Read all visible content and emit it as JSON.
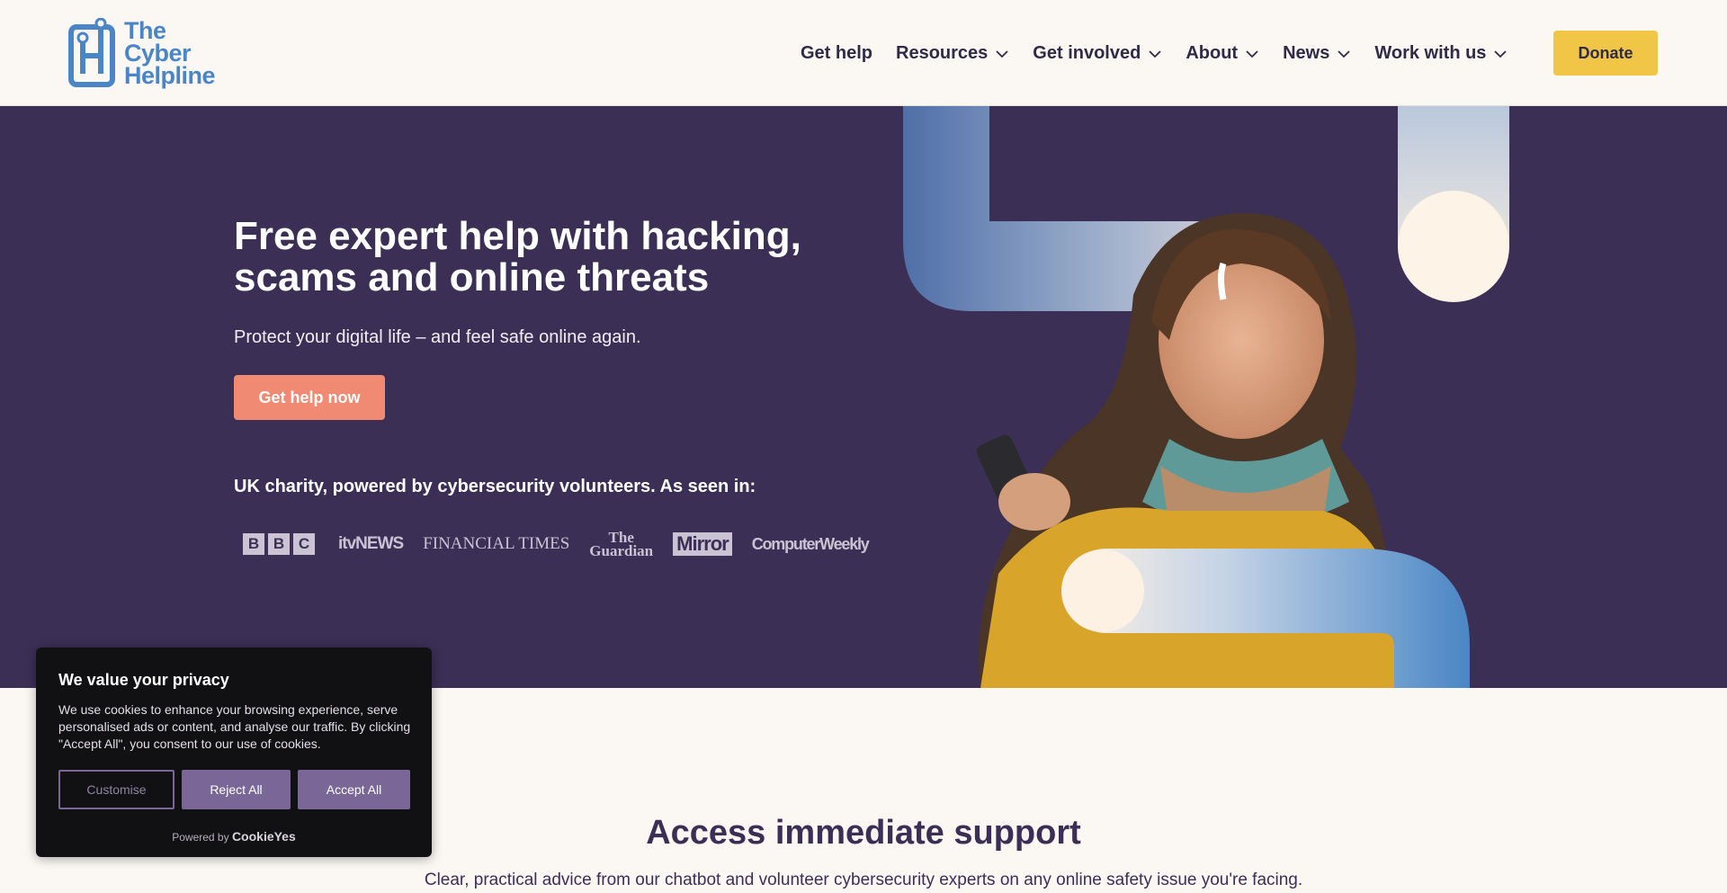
{
  "header": {
    "logo_lines": [
      "The",
      "Cyber",
      "Helpline"
    ],
    "nav": [
      {
        "label": "Get help",
        "dropdown": false
      },
      {
        "label": "Resources",
        "dropdown": true
      },
      {
        "label": "Get involved",
        "dropdown": true
      },
      {
        "label": "About",
        "dropdown": true
      },
      {
        "label": "News",
        "dropdown": true
      },
      {
        "label": "Work with us",
        "dropdown": true
      }
    ],
    "donate_label": "Donate"
  },
  "hero": {
    "title": "Free expert help with hacking, scams and online threats",
    "subtitle": "Protect your digital life – and feel safe online again.",
    "cta_label": "Get help now",
    "seen_in": "UK charity, powered by cybersecurity volunteers. As seen in:",
    "media": {
      "bbc": [
        "B",
        "B",
        "C"
      ],
      "itv": "itvNEWS",
      "ft": "FINANCIAL TIMES",
      "guardian_lines": [
        "The",
        "Guardian"
      ],
      "mirror": "Mirror",
      "computer_weekly": "ComputerWeekly"
    }
  },
  "support": {
    "title": "Access immediate support",
    "subtitle": "Clear, practical advice from our chatbot and volunteer cybersecurity experts on any online safety issue you're facing."
  },
  "cookie": {
    "title": "We value your privacy",
    "body": "We use cookies to enhance your browsing experience, serve personalised ads or content, and analyse our traffic. By clicking \"Accept All\", you consent to our use of cookies.",
    "customise_label": "Customise",
    "reject_label": "Reject All",
    "accept_label": "Accept All",
    "powered_prefix": "Powered by",
    "powered_brand": "CookieYes"
  },
  "colors": {
    "hero_bg": "#3b2f55",
    "donate": "#f1c646",
    "cta": "#f18a72",
    "logo_blue": "#4a86c5",
    "cookie_button": "#7a6797"
  }
}
